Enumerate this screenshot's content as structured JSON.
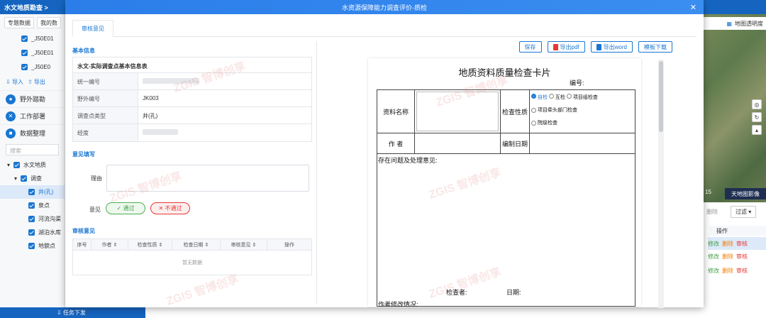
{
  "background": {
    "app_title": "水文地质勘查 >",
    "tabs": [
      "专题数据",
      "我的数"
    ],
    "layers": [
      "_J50E01",
      "_J50E01",
      "_J50E0"
    ],
    "tools": {
      "import": "导入",
      "export": "导出"
    },
    "sections": [
      {
        "icon": "person-icon",
        "label": "野外踏勘"
      },
      {
        "icon": "wrench-icon",
        "label": "工作部署"
      },
      {
        "icon": "layers-icon",
        "label": "数据整理"
      }
    ],
    "search_placeholder": "搜索",
    "tree": [
      {
        "label": "水文地质",
        "level": 0,
        "selected": false
      },
      {
        "label": "调查",
        "level": 1,
        "selected": false
      },
      {
        "label": "井(孔)",
        "level": 2,
        "selected": true
      },
      {
        "label": "泉点",
        "level": 2,
        "selected": false
      },
      {
        "label": "河流沟渠",
        "level": 2,
        "selected": false
      },
      {
        "label": "湖泊水库",
        "level": 2,
        "selected": false
      },
      {
        "label": "地貌点",
        "level": 2,
        "selected": false
      }
    ],
    "bottom_label": "任务下发",
    "map": {
      "transparency_label": "地图透明度",
      "basemap_label": "天地图影像",
      "zoom_level": "15",
      "filter_label": "过滤",
      "delete_label": "删除",
      "ops_header": "操作",
      "ops": {
        "edit": "修改",
        "delete": "删除",
        "audit": "审核"
      }
    }
  },
  "modal": {
    "title": "水资源保障能力调查评价-质检",
    "tab": "审核意见",
    "basic_info": {
      "section_title": "基本信息",
      "table_title": "水文-实际调查点基本信息表",
      "rows": [
        {
          "key": "统一编号",
          "value": ""
        },
        {
          "key": "野外编号",
          "value": "JK003"
        },
        {
          "key": "调查点类型",
          "value": "井(孔)"
        },
        {
          "key": "经度",
          "value": ""
        }
      ]
    },
    "opinion": {
      "section_title": "意见填写",
      "reason_label": "理由",
      "opinion_label": "意见",
      "pass_label": "✓ 通过",
      "fail_label": "✕ 不通过"
    },
    "audit": {
      "section_title": "审核意见",
      "columns": [
        "序号",
        "作者",
        "检查性质",
        "检查日期",
        "审核意见",
        "操作"
      ],
      "empty": "暂无数据"
    },
    "toolbar": {
      "save": "保存",
      "export_pdf": "导出pdf",
      "export_word": "导出word",
      "template": "模板下载"
    },
    "card": {
      "title": "地质资料质量检查卡片",
      "number_label": "编号:",
      "material_name_label": "资料名称",
      "check_nature_label": "检查性质",
      "author_label": "作    者",
      "compile_date_label": "编制日期",
      "check_options": [
        "自检",
        "互检",
        "项目组检查",
        "项目牵头部门检查",
        "院级检查"
      ],
      "selected_option": "自检",
      "issues_label": "存在问题及处理意见:",
      "inspector_label": "检查者:",
      "date_label": "日期:",
      "modify_label": "作者修改情况:"
    },
    "watermark": "ZGIS 智博创享"
  }
}
